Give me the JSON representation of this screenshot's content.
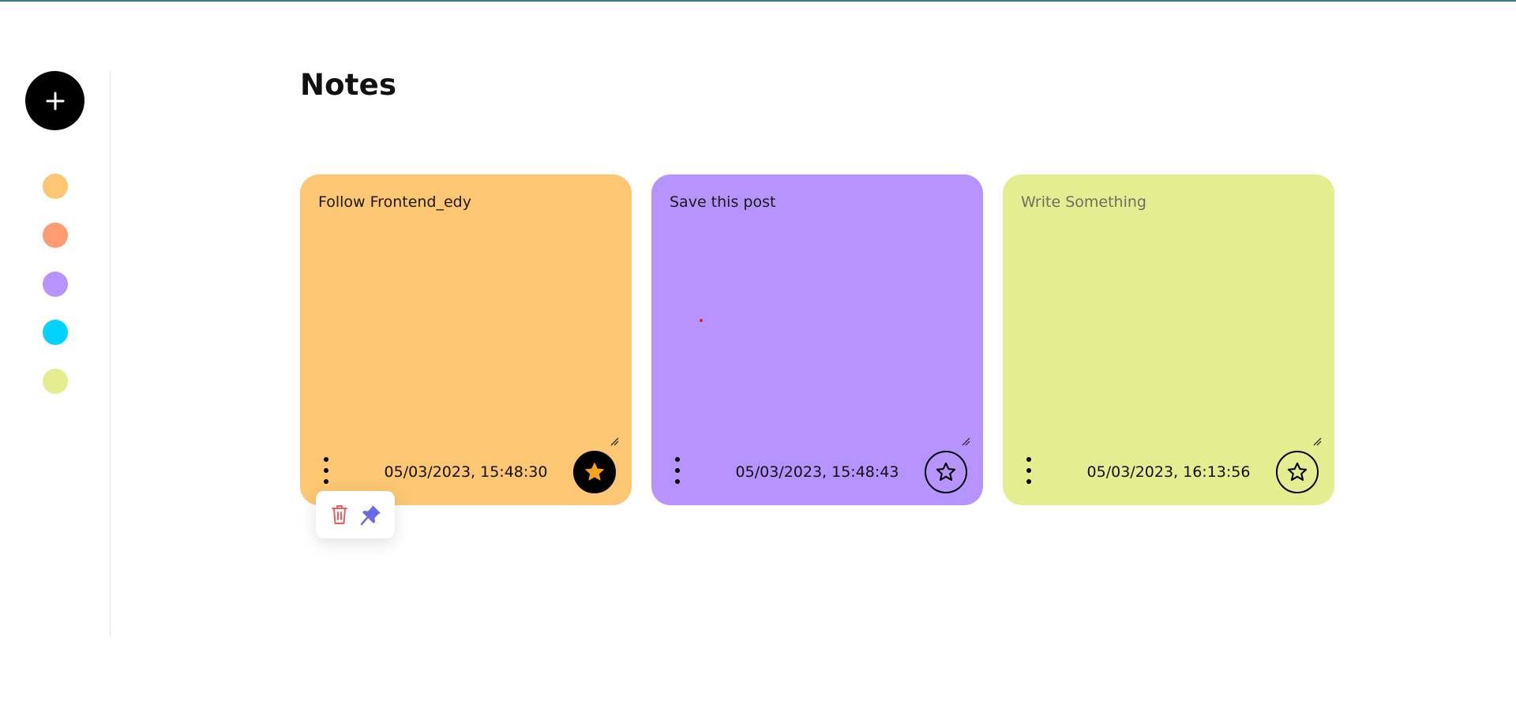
{
  "page": {
    "title": "Notes"
  },
  "sidebar": {
    "add_icon": "plus-icon",
    "colors": [
      {
        "name": "orange",
        "hex": "#fdc672"
      },
      {
        "name": "coral",
        "hex": "#fe9b72"
      },
      {
        "name": "purple",
        "hex": "#b693fd"
      },
      {
        "name": "cyan",
        "hex": "#00d4fe"
      },
      {
        "name": "lime",
        "hex": "#e4ee91"
      }
    ]
  },
  "notes": [
    {
      "text": "Follow Frontend_edy",
      "placeholder": "Write Something",
      "timestamp": "05/03/2023, 15:48:30",
      "color": "#fdc672",
      "starred": true
    },
    {
      "text": "Save this post",
      "placeholder": "Write Something",
      "timestamp": "05/03/2023, 15:48:43",
      "color": "#b693fd",
      "starred": false
    },
    {
      "text": "",
      "placeholder": "Write Something",
      "timestamp": "05/03/2023, 16:13:56",
      "color": "#e4ee91",
      "starred": false
    }
  ],
  "popup": {
    "items": [
      {
        "icon": "trash-icon",
        "color": "#f05a5a"
      },
      {
        "icon": "pin-icon",
        "color": "#6a6ae8"
      }
    ]
  }
}
